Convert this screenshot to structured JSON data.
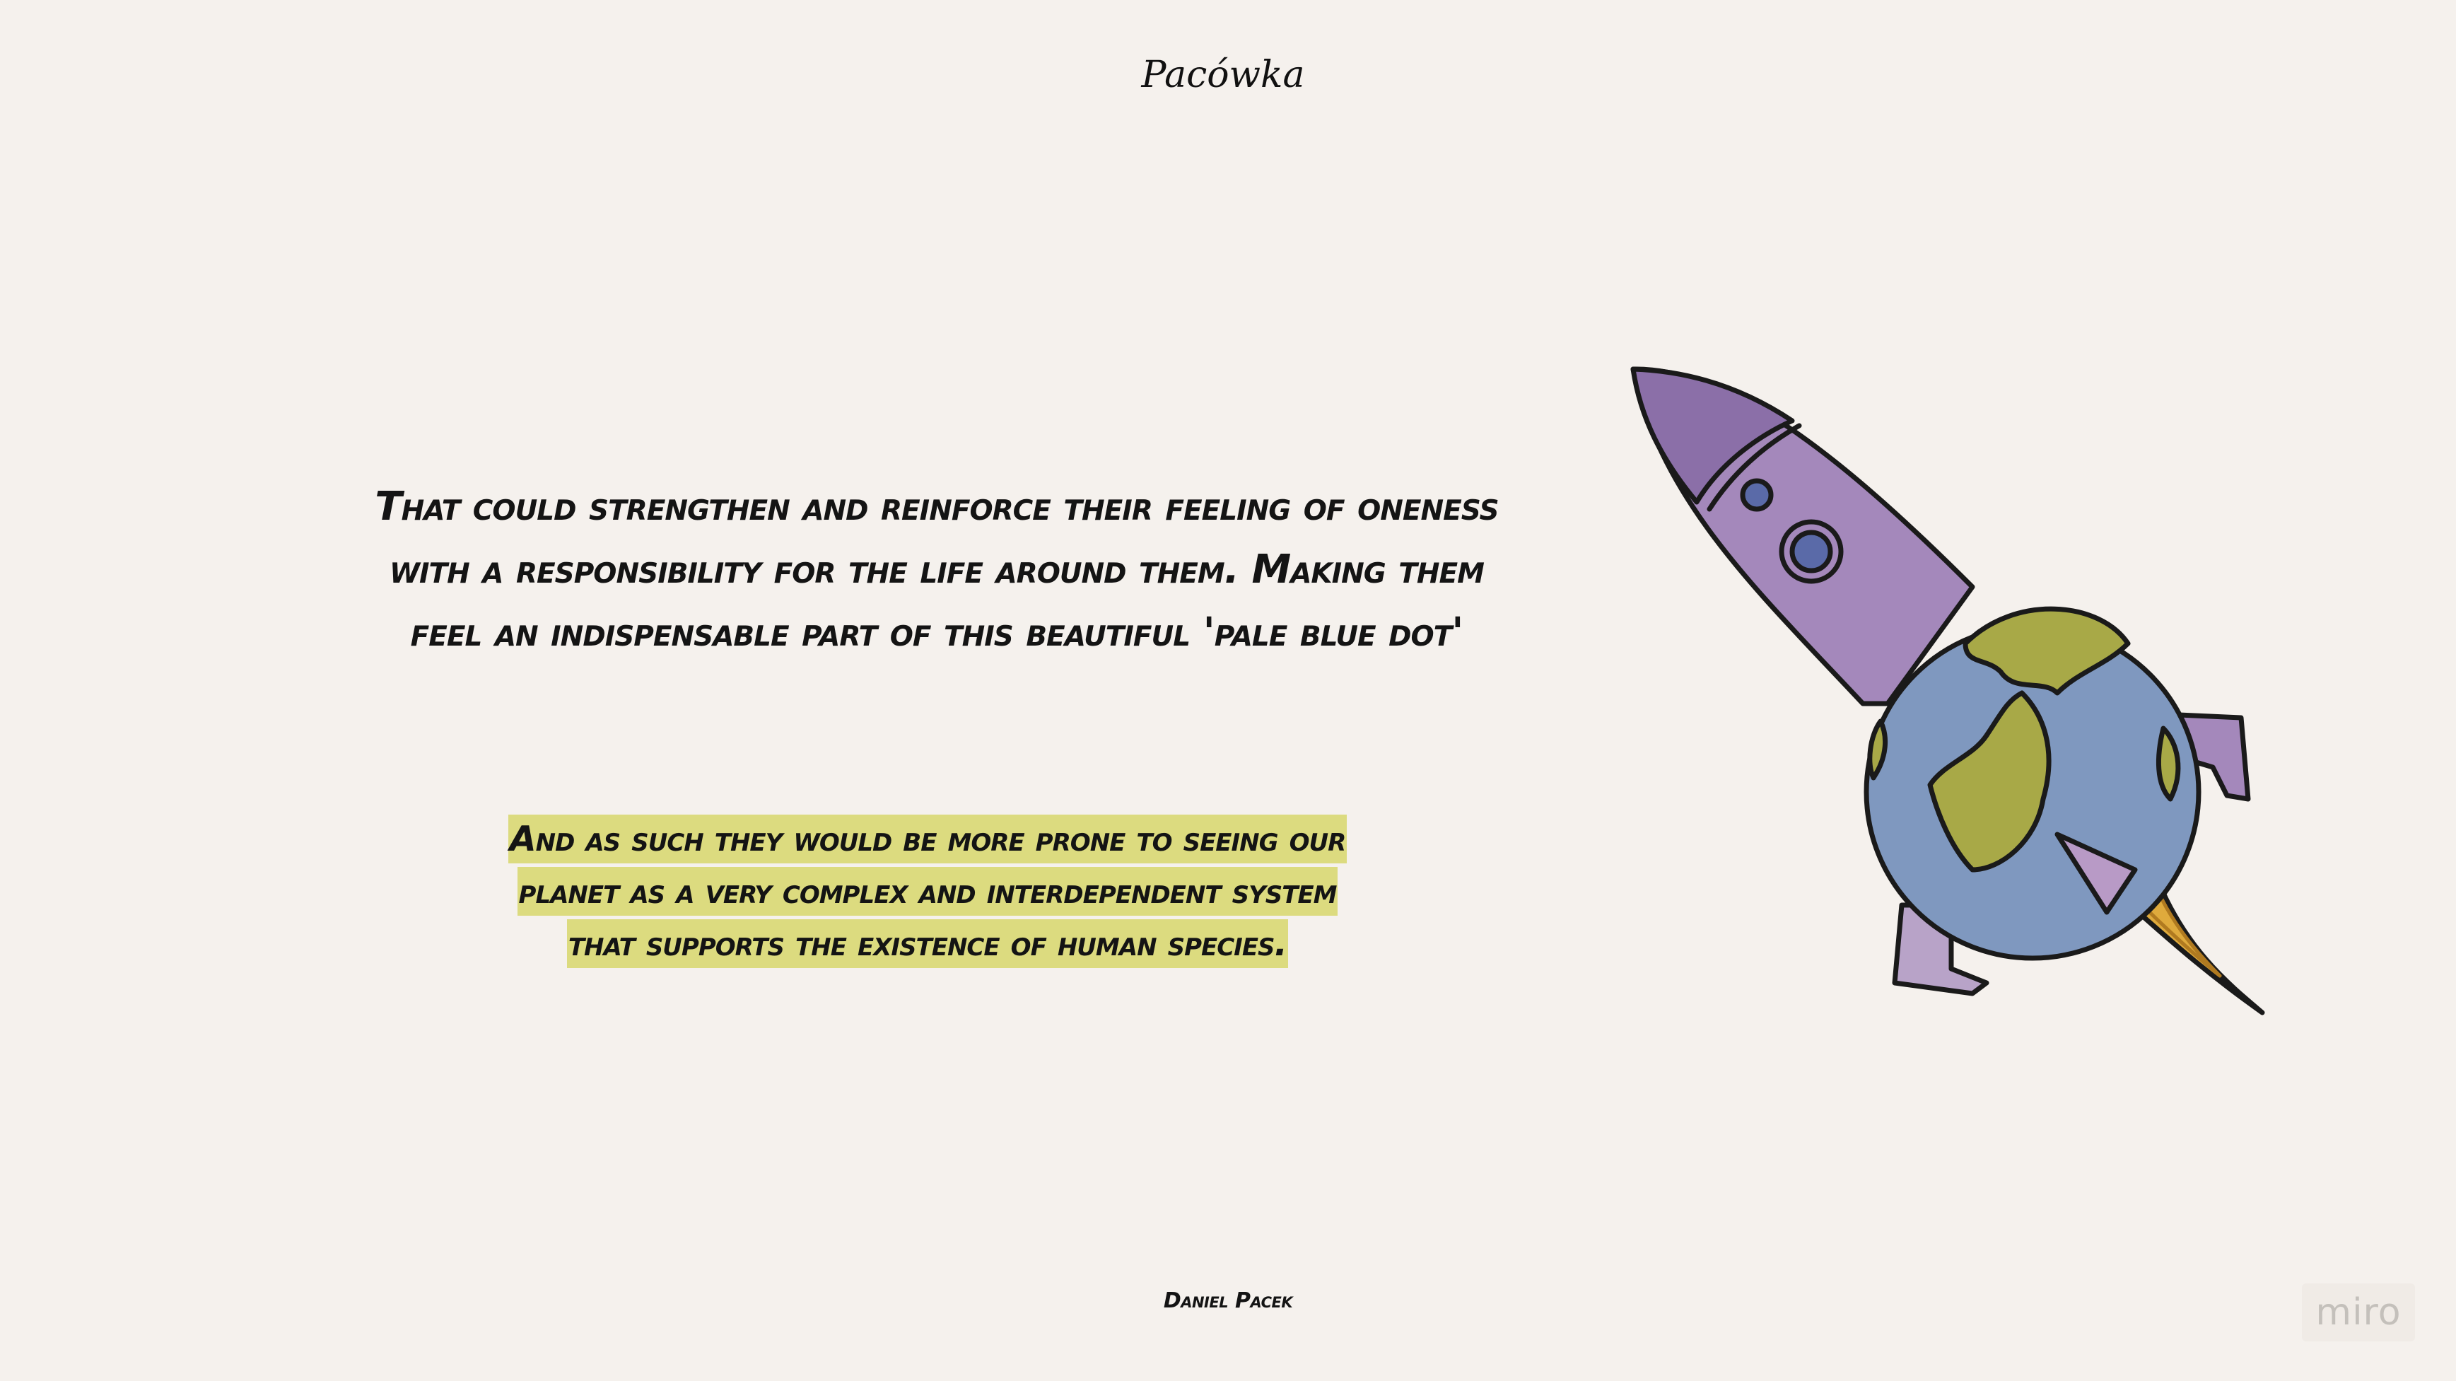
{
  "logo": {
    "text": "Pacówka"
  },
  "quote": {
    "text": "That could strengthen and reinforce their feeling of oneness with a responsibility for the life around them. Making them feel an indispensable part of this beautiful 'pale blue dot'"
  },
  "highlight": {
    "text": "And as such they would be more prone to seeing our planet as a very complex and interdependent system that supports the existence of human species."
  },
  "author": {
    "name": "Daniel Pacek"
  },
  "miro": {
    "label": "miro"
  },
  "illustration": {
    "icon": "rocket-earth-icon",
    "colors": {
      "rocket_body": "#a488bb",
      "rocket_nose": "#8b6fa8",
      "earth_ocean": "#7f98bf",
      "earth_land": "#a8a947",
      "flame": "#dfaa3c",
      "window": "#5a6aa8"
    }
  },
  "colors": {
    "background": "#f5f1ed",
    "highlight": "#dcdb7f",
    "text": "#141414"
  }
}
